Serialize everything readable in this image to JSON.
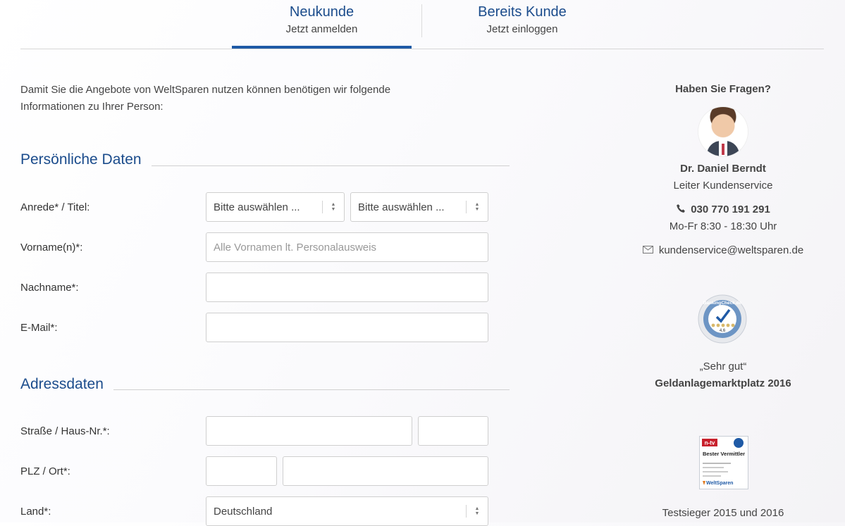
{
  "tabs": {
    "new_title": "Neukunde",
    "new_sub": "Jetzt anmelden",
    "existing_title": "Bereits Kunde",
    "existing_sub": "Jetzt einloggen"
  },
  "intro": "Damit Sie die Angebote von WeltSparen nutzen können benötigen wir folgende Informationen zu Ihrer Person:",
  "personal": {
    "title": "Persönliche Daten",
    "salutation_label": "Anrede* / Titel:",
    "salutation_value": "Bitte auswählen ...",
    "title_value": "Bitte auswählen ...",
    "firstname_label": "Vorname(n)*:",
    "firstname_placeholder": "Alle Vornamen lt. Personalausweis",
    "lastname_label": "Nachname*:",
    "email_label": "E-Mail*:"
  },
  "address": {
    "title": "Adressdaten",
    "street_label": "Straße / Haus-Nr.*:",
    "zip_label": "PLZ / Ort*:",
    "country_label": "Land*:",
    "country_value": "Deutschland"
  },
  "contact": {
    "question": "Haben Sie Fragen?",
    "name": "Dr. Daniel Berndt",
    "role": "Leiter Kundenservice",
    "phone": "030 770 191 291",
    "hours": "Mo-Fr 8:30 - 18:30 Uhr",
    "email": "kundenservice@weltsparen.de"
  },
  "awards": {
    "rating_quote": "„Sehr gut“",
    "rating_title": "Geldanlagemarktplatz 2016",
    "rating_badge_text": "BankingCheck.de",
    "rating_score": "4,6",
    "ntv_logo": "n-tv",
    "ntv_title": "Bester Vermittler",
    "ntv_brand": "WeltSparen",
    "test_text": "Testsieger 2015 und 2016"
  },
  "colors": {
    "accent": "#1f5aa6",
    "heading": "#1b4c8c"
  },
  "icons": [
    "phone-icon",
    "mail-icon",
    "select-arrows-icon"
  ]
}
